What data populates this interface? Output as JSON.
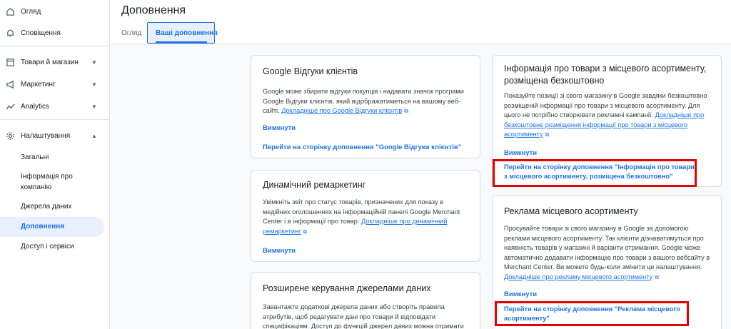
{
  "sidebar": {
    "overview": "Огляд",
    "notifications": "Сповіщення",
    "products_store": "Товари й магазин",
    "marketing": "Маркетинг",
    "analytics": "Analytics",
    "settings": "Налаштування",
    "sub": {
      "general": "Загальні",
      "company_info": "Інформація про компанію",
      "data_sources": "Джерела даних",
      "addons": "Доповнення",
      "access": "Доступ і сервіси"
    }
  },
  "header": {
    "title": "Доповнення",
    "tabs": [
      "Огляд",
      "Ваші доповнення"
    ]
  },
  "cards": {
    "reviews": {
      "title": "Google Відгуки клієнтів",
      "desc": "Google може збирати відгуки покупців і надавати значок програми Google Відгуки клієнтів, який відображатиметься на вашому веб-сайті.",
      "link": "Докладніше про Google Відгуки клієнтів",
      "disable": "Вимкнути",
      "goto": "Перейти на сторінку доповнення \"Google Відгуки клієнтів\""
    },
    "remarketing": {
      "title": "Динамічний ремаркетинг",
      "desc": "Увімкніть звіт про статус товарів, призначених для показу в медійних оголошеннях на інформаційній панелі Google Merchant Center і в інформації про товар.",
      "link": "Докладніше про динамічний ремаркетинг",
      "disable": "Вимкнути"
    },
    "feeds": {
      "title": "Розширене керування джерелами даних",
      "desc": "Завантажте додаткові джерела даних або створіть правила атрибутів, щоб редагувати дані про товари й відповідати специфікаціям. Доступ до функцій джерел даних можна отримати"
    },
    "local_free": {
      "title": "Інформація про товари з місцевого асортименту, розміщена безкоштовно",
      "desc": "Показуйте позиції зі свого магазину в Google завдяки безкоштовно розміщеній інформації про товари з місцевого асортименту. Для цього не потрібно створювати рекламні кампанії.",
      "link": "Докладніше про безкоштовне розміщення інформації про товари з місцевого асортименту",
      "disable": "Вимкнути",
      "goto": "Перейти на сторінку доповнення \"Інформація про товари з місцевого асортименту, розміщена безкоштовно\""
    },
    "local_ads": {
      "title": "Реклама місцевого асортименту",
      "desc": "Просувайте товари зі свого магазину в Google за допомогою реклами місцевого асортименту. Так клієнти дізнаватимуться про наявність товарів у магазині й варіанти отримання. Google може автоматично додавати інформацію про товари з вашого вебсайту в Merchant Center. Ви можете будь-коли змінити це налаштування.",
      "link": "Докладніше про рекламу місцевого асортименту",
      "disable": "Вимкнути",
      "goto": "Перейти на сторінку доповнення \"Реклама місцевого асортименту\""
    }
  },
  "colors": {
    "accent": "#1a73e8",
    "highlight": "#e50000"
  },
  "icons": [
    "home-icon",
    "bell-icon",
    "store-icon",
    "megaphone-icon",
    "analytics-icon",
    "gear-icon",
    "external-link-icon",
    "chevron-down-icon",
    "chevron-up-icon"
  ]
}
